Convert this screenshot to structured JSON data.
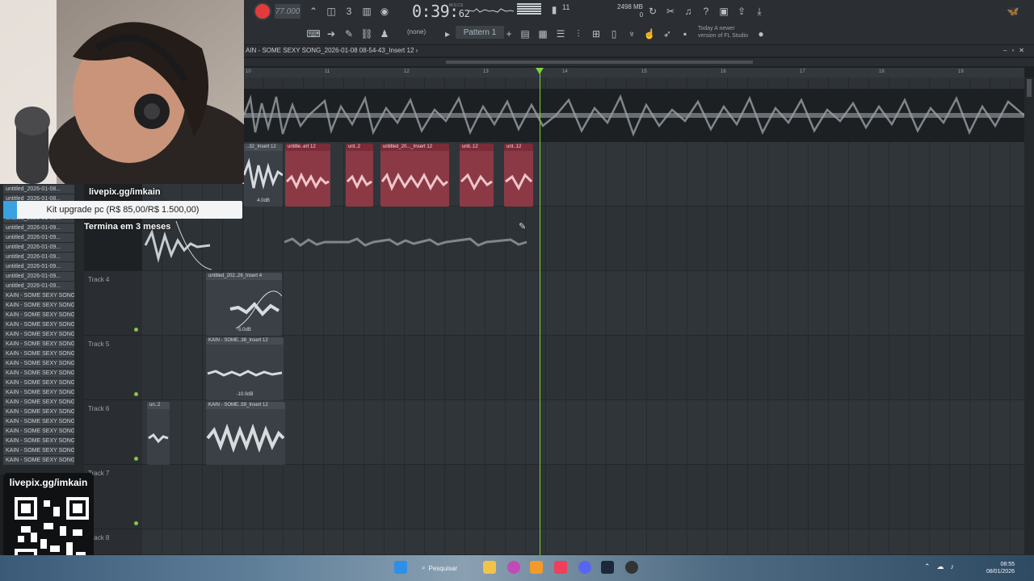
{
  "toolbar": {
    "tempo": "77.000",
    "time_main": "0:39:",
    "time_frac": "62",
    "time_unit": "M:S:CS",
    "cpu_value": "11",
    "memory": "2498 MB",
    "memory_sub": "0",
    "pattern_mode": "(none)",
    "pattern": "Pattern 1",
    "news_line1": "Today  A newer",
    "news_line2": "version of FL Studio"
  },
  "playlist": {
    "title": "AIN - SOME SEXY SONG_2026-01-08 08-54-43_Insert 12 ›",
    "ruler_ticks": [
      "10",
      "11",
      "12",
      "13",
      "14",
      "15",
      "16",
      "17",
      "18",
      "19"
    ],
    "tracks": [
      {
        "name": "Track 4"
      },
      {
        "name": "Track 5"
      },
      {
        "name": "Track 6"
      },
      {
        "name": "Track 7"
      },
      {
        "name": "Track 8"
      }
    ],
    "clips": {
      "lane2_grey": "..32_Insert 12",
      "lane2_grey_db": "4.0dB",
      "red1": "untitle..ert 12",
      "red2": "unt..2",
      "red3": "untitled_20..._Insert 12",
      "red4": "unti..12",
      "red5": "unt..12",
      "t4_clip": "untitled_202..26_Insert 4",
      "t4_db": "-5.0dB",
      "t5_clip": "KAIN - SOME..38_Insert 12",
      "t5_db": "-10.0dB",
      "t6_clip_a": "un..2",
      "t6_clip_b": "KAIN - SOME..59_Insert 12"
    }
  },
  "browser": {
    "items": [
      "untitled_2026-01-08...",
      "untitled_2026-01-08...",
      "untitled_2026-01-08...",
      "untitled_2026-01-08...",
      "untitled_2026-01-09...",
      "untitled_2026-01-09...",
      "untitled_2026-01-09...",
      "untitled_2026-01-09...",
      "untitled_2026-01-09...",
      "untitled_2026-01-09...",
      "untitled_2026-01-09...",
      "KAIN - SOME SEXY SONG...",
      "KAIN - SOME SEXY SONG...",
      "KAIN - SOME SEXY SONG...",
      "KAIN - SOME SEXY SONG...",
      "KAIN - SOME SEXY SONG...",
      "KAIN - SOME SEXY SONG...",
      "KAIN - SOME SEXY SONG...",
      "KAIN - SOME SEXY SONG...",
      "KAIN - SOME SEXY SONG...",
      "KAIN - SOME SEXY SONG...",
      "KAIN - SOME SEXY SONG...",
      "KAIN - SOME SEXY SONG...",
      "KAIN - SOME SEXY SONG...",
      "KAIN - SOME SEXY SONG...",
      "KAIN - SOME SEXY SONG...",
      "KAIN - SOME SEXY SONG...",
      "KAIN - SOME SEXY SONG...",
      "KAIN - SOME SEXY SONG..."
    ]
  },
  "overlay": {
    "link_top": "livepix.gg/imkain",
    "goal_text": "Kit upgrade pc (R$ 85,00/R$ 1.500,00)",
    "goal_progress": 0.057,
    "ends": "Termina em 3 meses",
    "link_qr": "livepix.gg/imkain"
  },
  "taskbar": {
    "search": "Pesquisar",
    "clock_time": "08:55",
    "clock_date": "08/01/2026"
  },
  "colors": {
    "accent_record": "#e23b3b",
    "playhead": "#7bd33b",
    "clip_red": "#8b3a45",
    "goal_fill": "#3aa2e0"
  }
}
